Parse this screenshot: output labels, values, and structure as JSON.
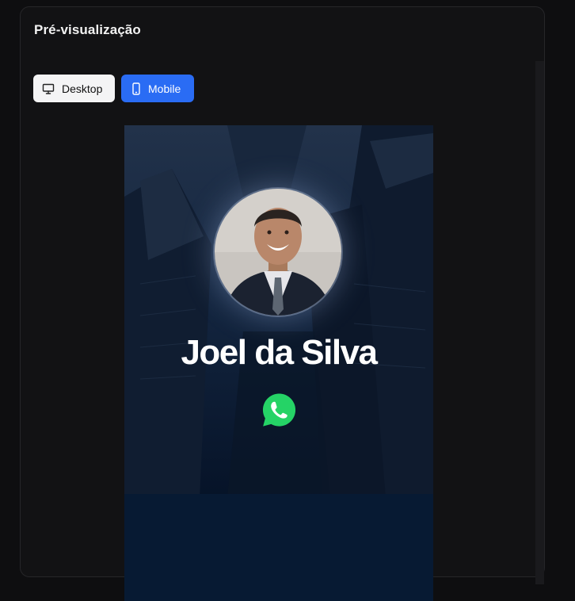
{
  "panel": {
    "title": "Pré-visualização"
  },
  "view_toggle": {
    "desktop_label": "Desktop",
    "mobile_label": "Mobile",
    "selected": "Mobile"
  },
  "preview": {
    "name": "Joel da Silva",
    "contact_icon": "whatsapp-icon",
    "lower_section_text": ""
  },
  "colors": {
    "page_bg": "#0e0e10",
    "panel_bg": "#121214",
    "accent": "#2a6cf4",
    "card_bg": "#071427",
    "whatsapp_green": "#25d366"
  }
}
